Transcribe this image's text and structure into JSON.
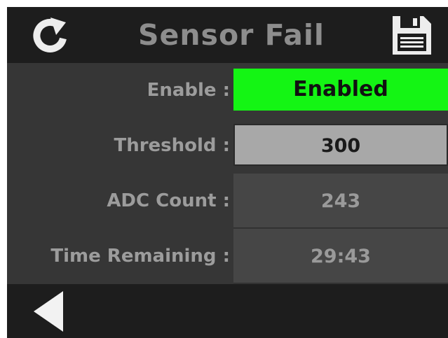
{
  "header": {
    "title": "Sensor Fail",
    "refresh_icon": "refresh-icon",
    "save_icon": "save-icon"
  },
  "settings": [
    {
      "label": "Enable :",
      "value": "Enabled"
    },
    {
      "label": "Threshold :",
      "value": "300"
    },
    {
      "label": "ADC Count :",
      "value": "243"
    },
    {
      "label": "Time Remaining :",
      "value": "29:43"
    }
  ],
  "footer": {
    "back_icon": "back-arrow-icon"
  },
  "colors": {
    "enabled_bg": "#14f514",
    "threshold_bg": "#a8a8a8",
    "header_bg": "#1d1d1d",
    "body_bg": "#363636",
    "title_text": "#8d8d8d"
  }
}
